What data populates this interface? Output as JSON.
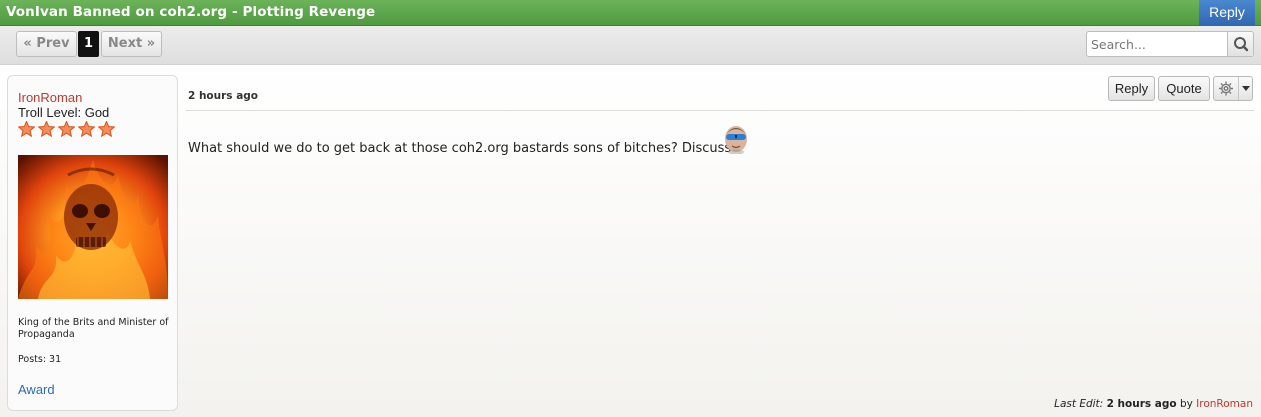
{
  "thread": {
    "title": "VonIvan Banned on coh2.org - Plotting Revenge",
    "reply_label": "Reply"
  },
  "pager": {
    "prev_label": "« Prev",
    "current_page": "1",
    "next_label": "Next »"
  },
  "search": {
    "placeholder": "Search...",
    "icon": "magnifier-icon"
  },
  "post": {
    "author": {
      "name": "IronRoman",
      "troll_level": "Troll Level: God",
      "stars": 5,
      "avatar": "flaming-skull-image",
      "title": "King of the Brits and Minister of Propaganda",
      "posts": "Posts: 31",
      "award_label": "Award"
    },
    "time": "2 hours ago",
    "actions": {
      "reply_label": "Reply",
      "quote_label": "Quote",
      "options_icon": "gear-icon"
    },
    "message": "What should we do to get back at those coh2.org bastards sons of bitches? Discuss",
    "emoji": "sunglasses-face-icon",
    "last_edit": {
      "label": "Last Edit:",
      "when": "2 hours ago",
      "by": "by",
      "who": "IronRoman"
    }
  },
  "colors": {
    "title_bar": "#5aa648",
    "reply_button": "#3a78c2",
    "username": "#c0392b",
    "link": "#2a6db5"
  }
}
